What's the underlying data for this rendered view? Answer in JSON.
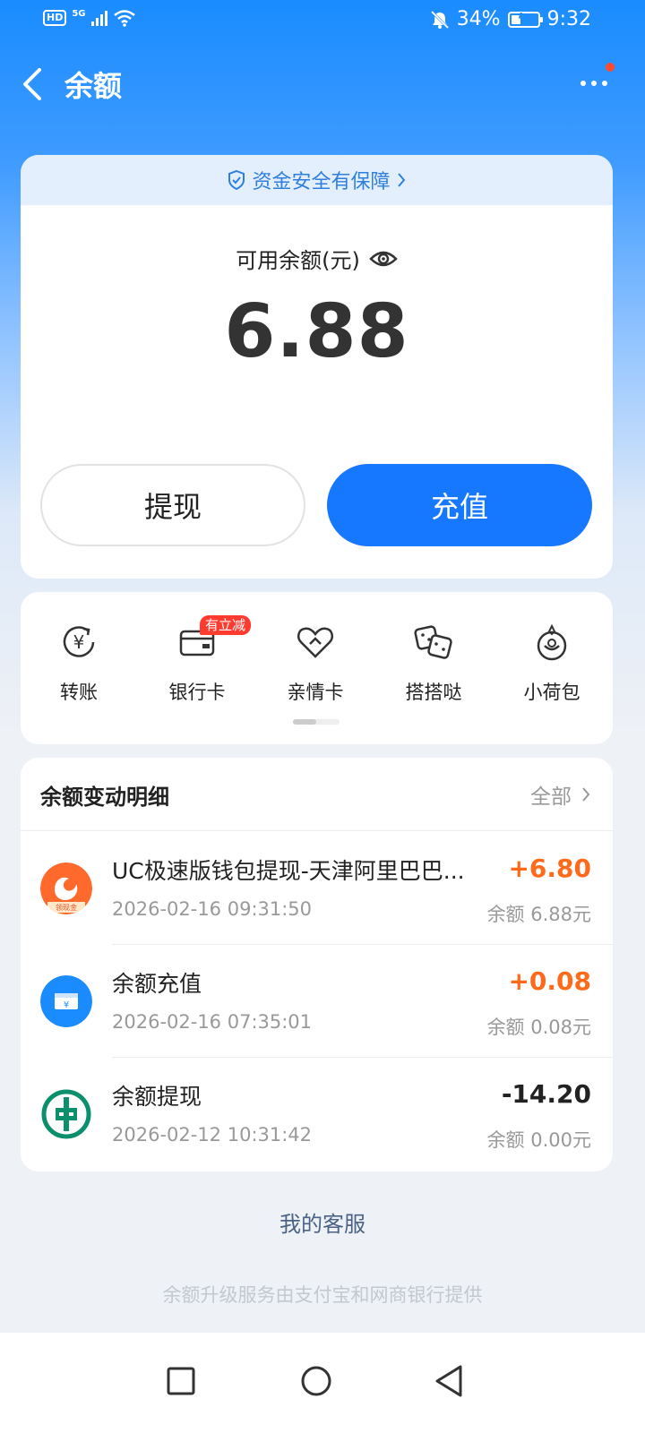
{
  "status_bar": {
    "hd": "HD",
    "network": "5G",
    "battery_percent": "34%",
    "battery_level": 0.34,
    "time": "9:32"
  },
  "header": {
    "title": "余额",
    "back_icon": "chevron-left-icon",
    "more_icon": "more-dots-icon"
  },
  "balance_card": {
    "security_text": "资金安全有保障",
    "available_label": "可用余额(元)",
    "amount": "6.88",
    "withdraw_label": "提现",
    "recharge_label": "充值"
  },
  "shortcuts": {
    "items": [
      {
        "label": "转账",
        "icon": "transfer-yuan-icon"
      },
      {
        "label": "银行卡",
        "icon": "bank-card-icon",
        "badge": "有立减"
      },
      {
        "label": "亲情卡",
        "icon": "family-card-heart-icon"
      },
      {
        "label": "搭搭哒",
        "icon": "dadada-dice-icon"
      },
      {
        "label": "小荷包",
        "icon": "small-purse-icon"
      }
    ]
  },
  "transactions": {
    "title": "余额变动明细",
    "all_label": "全部",
    "items": [
      {
        "name": "UC极速版钱包提现-天津阿里巴巴...",
        "time": "2026-02-16 09:31:50",
        "amount": "+6.80",
        "balance": "余额 6.88元",
        "icon": "uc-browser-icon",
        "icon_text": "领现金"
      },
      {
        "name": "余额充值",
        "time": "2026-02-16 07:35:01",
        "amount": "+0.08",
        "balance": "余额 0.08元",
        "icon": "recharge-yuan-icon"
      },
      {
        "name": "余额提现",
        "time": "2026-02-12 10:31:42",
        "amount": "-14.20",
        "balance": "余额 0.00元",
        "icon": "agricultural-bank-icon"
      }
    ]
  },
  "customer_service": "我的客服",
  "footer_note": "余额升级服务由支付宝和网商银行提供",
  "colors": {
    "primary": "#1677ff",
    "positive_amount": "#ff6a1a",
    "badge_red": "#ff3b30"
  }
}
